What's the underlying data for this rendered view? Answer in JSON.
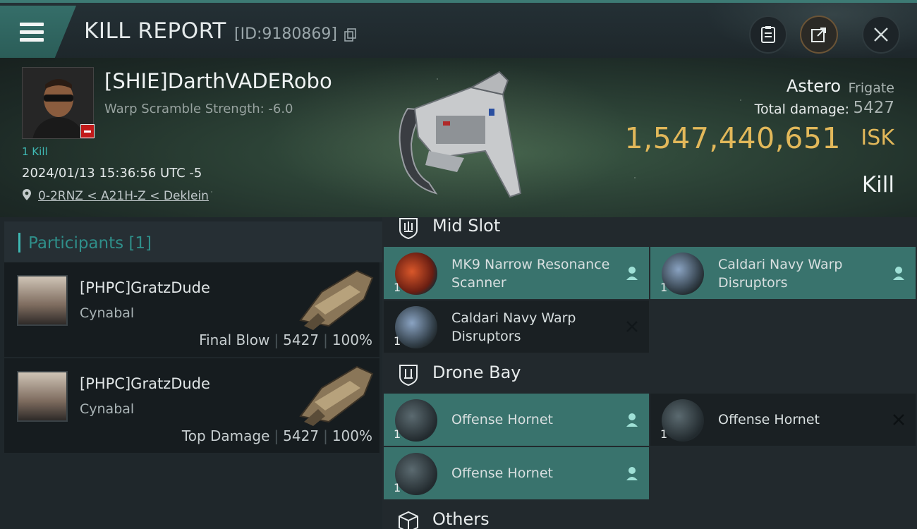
{
  "header": {
    "title": "KILL REPORT",
    "report_id": "[ID:9180869]"
  },
  "victim": {
    "name": "[SHIE]DarthVADERobo",
    "warp_scramble": "Warp Scramble Strength: -6.0",
    "kill_tag": "1 Kill",
    "timestamp": "2024/01/13 15:36:56 UTC -5",
    "location": "0-2RNZ < A21H-Z < Deklein"
  },
  "ship": {
    "name": "Astero",
    "class": "Frigate",
    "total_damage_label": "Total damage:",
    "total_damage_value": "5427",
    "isk_value": "1,547,440,651",
    "isk_unit": "ISK",
    "result": "Kill"
  },
  "participants": {
    "title": "Participants [1]",
    "list": [
      {
        "name": "[PHPC]GratzDude",
        "ship": "Cynabal",
        "role": "Final Blow",
        "damage": "5427",
        "percent": "100%"
      },
      {
        "name": "[PHPC]GratzDude",
        "ship": "Cynabal",
        "role": "Top Damage",
        "damage": "5427",
        "percent": "100%"
      }
    ]
  },
  "sections": {
    "mid_slot": {
      "title": "Mid Slot",
      "items": [
        {
          "name": "MK9 Narrow Resonance Scanner",
          "qty": "1",
          "status": "dropped"
        },
        {
          "name": "Caldari Navy Warp Disruptors",
          "qty": "1",
          "status": "dropped"
        },
        {
          "name": "Caldari Navy Warp Disruptors",
          "qty": "1",
          "status": "destroyed"
        }
      ]
    },
    "drone_bay": {
      "title": "Drone Bay",
      "items": [
        {
          "name": "Offense  Hornet",
          "qty": "1",
          "status": "dropped"
        },
        {
          "name": "Offense  Hornet",
          "qty": "1",
          "status": "destroyed"
        },
        {
          "name": "Offense  Hornet",
          "qty": "1",
          "status": "dropped"
        }
      ]
    },
    "others": {
      "title": "Others"
    }
  },
  "colors": {
    "accent_teal": "#39736d",
    "isk_gold": "#e2b85a",
    "kill_badge_red": "#c21a1a"
  },
  "icons": [
    "menu-icon",
    "copy-icon",
    "clipboard-icon",
    "share-icon",
    "close-icon",
    "location-pin-icon",
    "shield-icon",
    "box-icon",
    "person-icon",
    "x-icon"
  ]
}
